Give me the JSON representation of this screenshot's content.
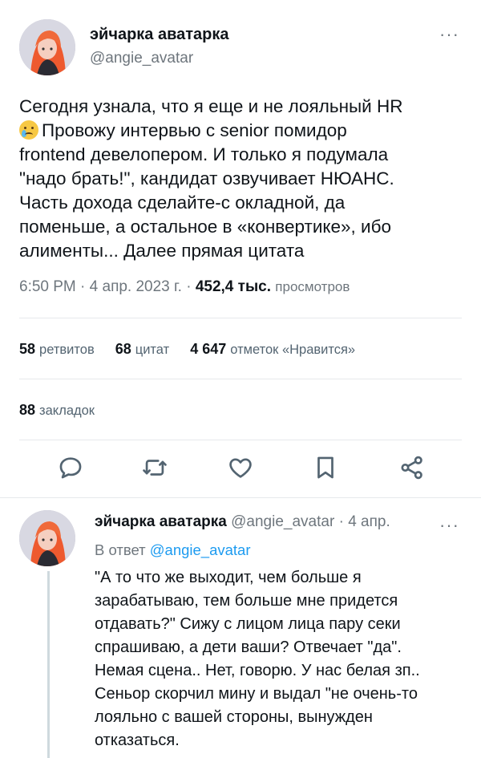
{
  "tweet": {
    "author_name": "эйчарка аватарка",
    "handle": "@angie_avatar",
    "more_label": "···",
    "text_lines": [
      "Сегодня узнала, что я еще и не лояльный HR",
      "Провожу интервью с senior помидор",
      "frontend девелопером. И только я подумала",
      "\"надо брать!\", кандидат озвучивает НЮАНС.",
      "Часть дохода сделайте-с окладной, да",
      "поменьше, а остальное в «конвертике», ибо",
      "алименты... Далее прямая цитата"
    ],
    "emoji_name": "crying-face-emoji",
    "time": "6:50 PM",
    "separator": " · ",
    "date": "4 апр. 2023 г.",
    "views_count": "452,4 тыс.",
    "views_label": "просмотров"
  },
  "stats": {
    "retweets_count": "58",
    "retweets_label": "ретвитов",
    "quotes_count": "68",
    "quotes_label": "цитат",
    "likes_count": "4 647",
    "likes_label": "отметок «Нравится»",
    "bookmarks_count": "88",
    "bookmarks_label": "закладок"
  },
  "actions": [
    {
      "name": "reply-icon"
    },
    {
      "name": "retweet-icon"
    },
    {
      "name": "like-icon"
    },
    {
      "name": "bookmark-icon"
    },
    {
      "name": "share-icon"
    }
  ],
  "reply": {
    "author_name": "эйчарка аватарка",
    "handle": "@angie_avatar",
    "separator": " · ",
    "date": "4 апр.",
    "more_label": "···",
    "reply_to_prefix": "В ответ ",
    "reply_to_handle": "@angie_avatar",
    "text_lines": [
      "\"А то что же выходит, чем больше я",
      "зарабатываю, тем больше мне придется",
      "отдавать?\" Сижу с лицом лица пару секи",
      "спрашиваю, а дети ваши? Отвечает \"да\".",
      "Немая сцена.. Нет, говорю. У нас белая зп..",
      "Сеньор скорчил мину и выдал \"не очень-то",
      "лояльно с вашей стороны, вынужден",
      "отказаться."
    ]
  },
  "colors": {
    "text": "#0f1419",
    "secondary": "#6e767d",
    "link": "#1d9bf0",
    "divider": "#e6e9ec",
    "hair": "#f0603a"
  }
}
